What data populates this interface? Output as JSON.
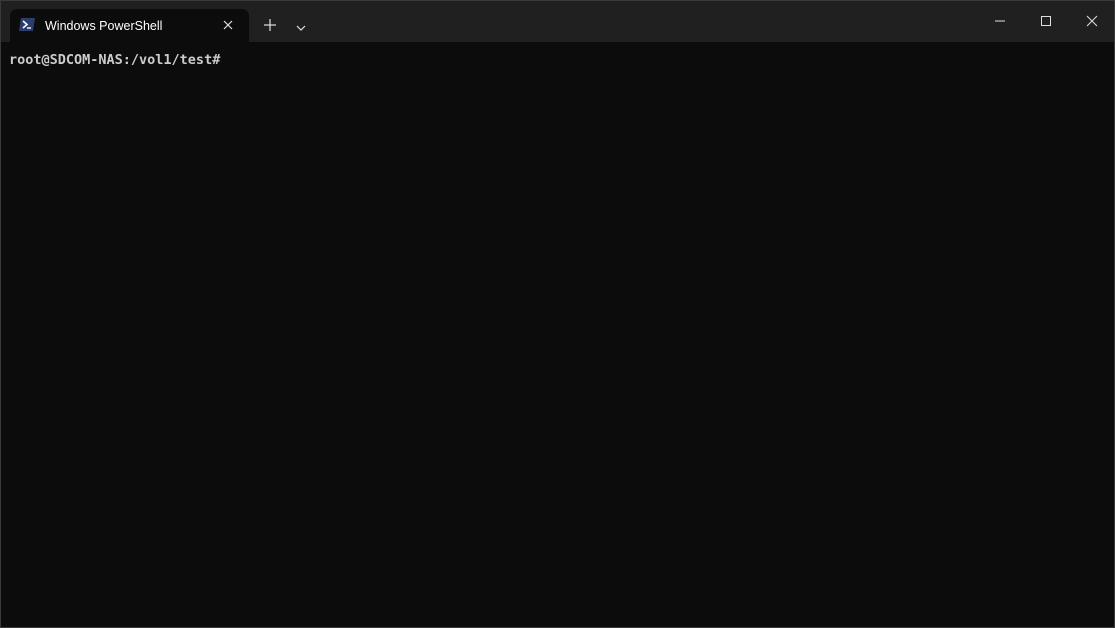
{
  "window": {
    "title": "Windows PowerShell"
  },
  "tab": {
    "label": "Windows PowerShell",
    "icon": "powershell-icon",
    "close_icon": "close-icon"
  },
  "toolbar": {
    "new_tab_icon": "plus-icon",
    "dropdown_icon": "chevron-down-icon"
  },
  "window_controls": {
    "minimize_icon": "minimize-icon",
    "maximize_icon": "maximize-icon",
    "close_icon": "close-icon"
  },
  "terminal": {
    "prompt": "root@SDCOM-NAS:/vol1/test#"
  },
  "colors": {
    "titlebar": "#202020",
    "terminal_bg": "#0c0c0c",
    "text": "#cccccc",
    "powershell_icon": "#2c3e63"
  }
}
